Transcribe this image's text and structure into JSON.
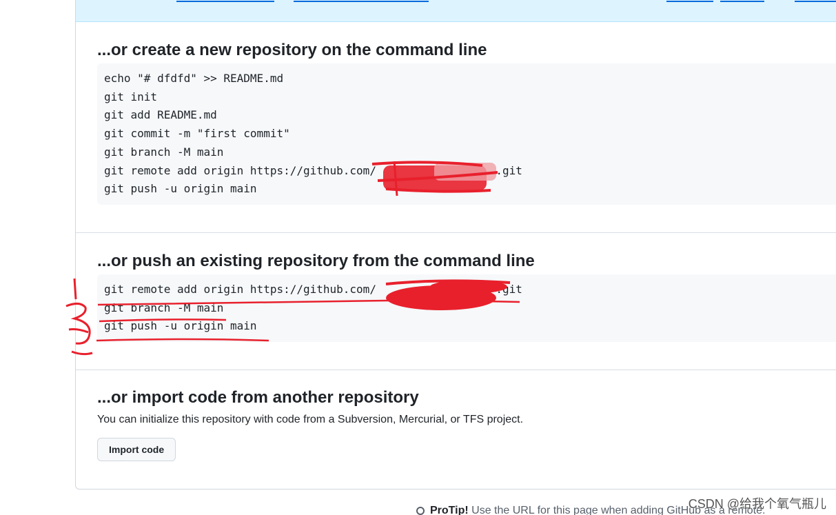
{
  "create_section": {
    "heading": "...or create a new repository on the command line",
    "code_lines": [
      "echo \"# dfdfd\" >> README.md",
      "git init",
      "git add README.md",
      "git commit -m \"first commit\"",
      "git branch -M main",
      "git remote add origin https://github.com/                  .git",
      "git push -u origin main"
    ]
  },
  "push_section": {
    "heading": "...or push an existing repository from the command line",
    "code_lines": [
      "git remote add origin https://github.com/                  .git",
      "git branch -M main",
      "git push -u origin main"
    ]
  },
  "import_section": {
    "heading": "...or import code from another repository",
    "description": "You can initialize this repository with code from a Subversion, Mercurial, or TFS project.",
    "button_label": "Import code"
  },
  "footer": {
    "protip_label": "ProTip!",
    "protip_text": " Use the URL for this page when adding GitHub as a remote."
  },
  "watermark": "CSDN @给我个氧气瓶儿",
  "colors": {
    "banner_bg": "#ddf4ff",
    "link": "#0969da",
    "code_bg": "#f6f8fa",
    "annotation_red": "#e8202c"
  }
}
